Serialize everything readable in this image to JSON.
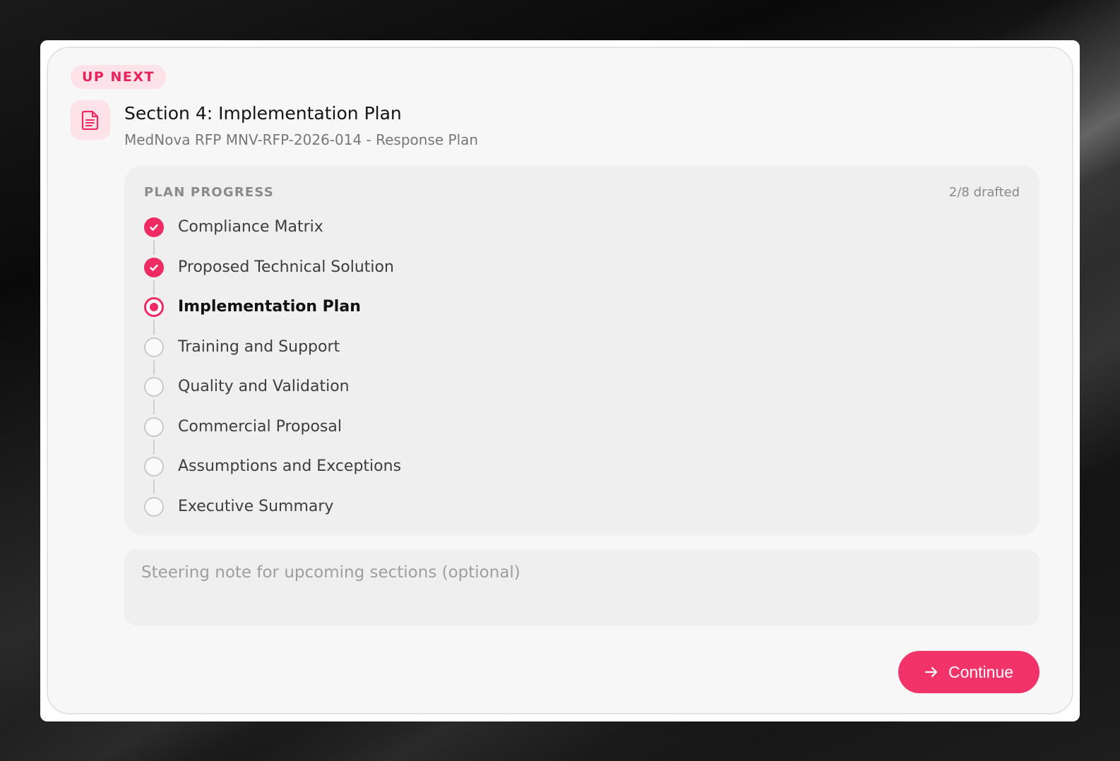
{
  "badge": "UP NEXT",
  "header": {
    "title": "Section 4: Implementation Plan",
    "subtitle": "MedNova RFP MNV-RFP-2026-014 - Response Plan"
  },
  "progress": {
    "label": "PLAN PROGRESS",
    "count": "2/8 drafted",
    "steps": [
      {
        "label": "Compliance Matrix",
        "status": "done"
      },
      {
        "label": "Proposed Technical Solution",
        "status": "done"
      },
      {
        "label": "Implementation Plan",
        "status": "current"
      },
      {
        "label": "Training and Support",
        "status": "todo"
      },
      {
        "label": "Quality and Validation",
        "status": "todo"
      },
      {
        "label": "Commercial Proposal",
        "status": "todo"
      },
      {
        "label": "Assumptions and Exceptions",
        "status": "todo"
      },
      {
        "label": "Executive Summary",
        "status": "todo"
      }
    ]
  },
  "note": {
    "placeholder": "Steering note for upcoming sections (optional)",
    "value": ""
  },
  "actions": {
    "continue_label": "Continue"
  },
  "colors": {
    "accent": "#ee2b63",
    "accent_soft": "#fde2ea"
  }
}
